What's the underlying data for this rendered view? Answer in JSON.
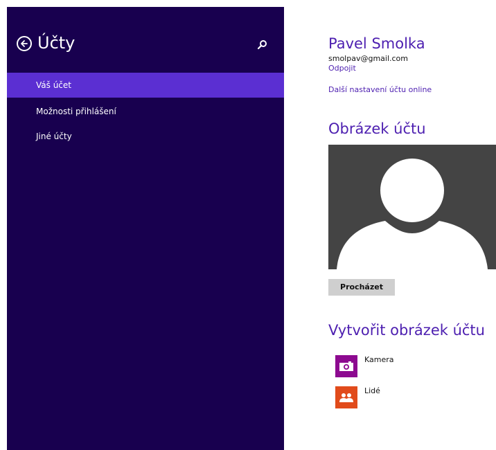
{
  "colors": {
    "sidebar_bg": "#18004f",
    "selected_item": "#5b2fd2",
    "accent": "#4d1fb0",
    "camera_tile": "#8d0a90",
    "people_tile": "#e14b1b"
  },
  "sidebar": {
    "title": "Účty",
    "back_icon": "back-arrow-circle-icon",
    "search_icon": "search-icon",
    "items": [
      {
        "label": "Váš účet",
        "selected": true
      },
      {
        "label": "Možnosti přihlášení",
        "selected": false
      },
      {
        "label": "Jiné účty",
        "selected": false
      }
    ]
  },
  "account": {
    "name": "Pavel Smolka",
    "email": "smolpav@gmail.com",
    "disconnect": "Odpojit",
    "more_settings": "Další nastavení účtu online"
  },
  "picture": {
    "title": "Obrázek účtu",
    "browse": "Procházet"
  },
  "create": {
    "title": "Vytvořit obrázek účtu",
    "apps": [
      {
        "label": "Kamera",
        "icon": "camera-icon"
      },
      {
        "label": "Lidé",
        "icon": "people-icon"
      }
    ]
  }
}
